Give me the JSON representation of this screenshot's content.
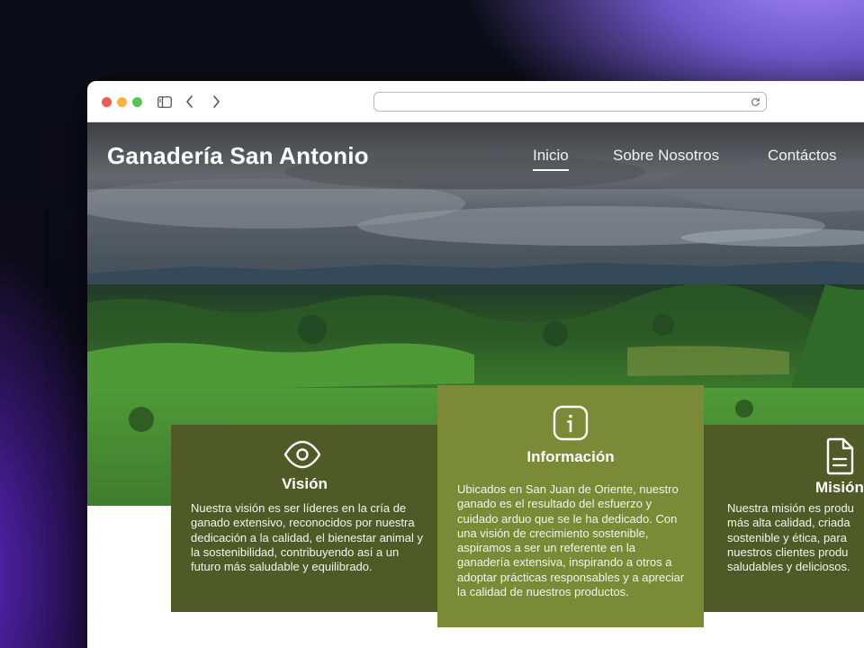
{
  "site": {
    "title": "Ganadería San Antonio"
  },
  "nav": {
    "items": [
      {
        "label": "Inicio",
        "active": true
      },
      {
        "label": "Sobre Nosotros",
        "active": false
      },
      {
        "label": "Contáctos",
        "active": false
      }
    ]
  },
  "browser": {
    "address": "",
    "icons": [
      "sidebar-icon",
      "back-icon",
      "forward-icon",
      "reload-icon"
    ]
  },
  "cards": {
    "vision": {
      "icon": "eye-icon",
      "title": "Visión",
      "text": "Nuestra visión es ser líderes en la cría de ganado extensivo, reconocidos por nuestra dedicación a la calidad, el bienestar animal y la sostenibilidad, contribuyendo así a un futuro más saludable y equilibrado."
    },
    "info": {
      "icon": "info-icon",
      "title": "Información",
      "text": "Ubicados en San Juan de Oriente, nuestro ganado es el resultado del esfuerzo y cuidado arduo que se le ha dedicado. Con una visión de crecimiento sostenible, aspiramos a ser un referente en la ganadería extensiva, inspirando a otros a adoptar prácticas responsables y a apreciar la calidad de nuestros productos."
    },
    "mision": {
      "icon": "document-icon",
      "title": "Misión",
      "lines": [
        "Nuestra misión es produ",
        "más alta calidad, criada",
        "sostenible y ética, para",
        "nuestros clientes produ",
        "saludables y deliciosos."
      ]
    }
  },
  "colors": {
    "card_dark": "#4f5a26",
    "card_light": "#7a8a36"
  }
}
